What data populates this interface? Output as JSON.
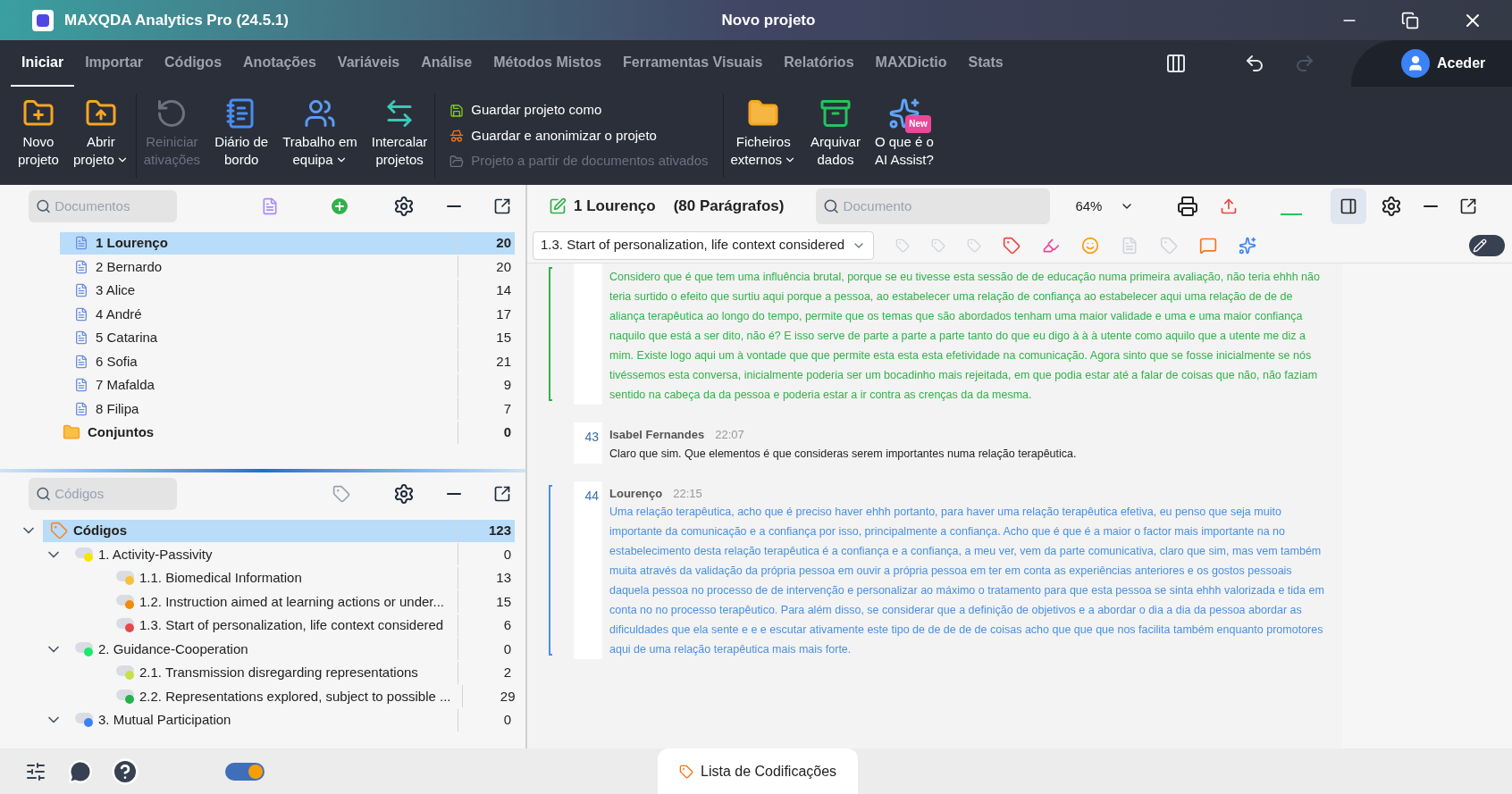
{
  "window": {
    "app_title": "MAXQDA Analytics Pro (24.5.1)",
    "project_title": "Novo projeto"
  },
  "menu_tabs": [
    {
      "label": "Iniciar",
      "selected": true
    },
    {
      "label": "Importar",
      "selected": false
    },
    {
      "label": "Códigos",
      "selected": false
    },
    {
      "label": "Anotações",
      "selected": false
    },
    {
      "label": "Variáveis",
      "selected": false
    },
    {
      "label": "Análise",
      "selected": false
    },
    {
      "label": "Métodos Mistos",
      "selected": false
    },
    {
      "label": "Ferramentas Visuais",
      "selected": false
    },
    {
      "label": "Relatórios",
      "selected": false
    },
    {
      "label": "MAXDictio",
      "selected": false
    },
    {
      "label": "Stats",
      "selected": false
    }
  ],
  "account": {
    "label": "Aceder"
  },
  "ribbon": [
    {
      "kind": "new",
      "lines": [
        "Novo",
        "projeto"
      ],
      "dropdown": false,
      "disabled": false
    },
    {
      "kind": "open",
      "lines": [
        "Abrir",
        "projeto"
      ],
      "dropdown": true,
      "disabled": false
    },
    {
      "kind": "reset",
      "lines": [
        "Reiniciar",
        "ativações"
      ],
      "dropdown": false,
      "disabled": true
    },
    {
      "kind": "logbook",
      "lines": [
        "Diário de",
        "bordo"
      ],
      "dropdown": false,
      "disabled": false
    },
    {
      "kind": "team",
      "lines": [
        "Trabalho em",
        "equipa"
      ],
      "dropdown": true,
      "disabled": false
    },
    {
      "kind": "merge",
      "lines": [
        "Intercalar",
        "projetos"
      ],
      "dropdown": false,
      "disabled": false
    },
    {
      "kind": "list",
      "items": [
        {
          "kind": "save",
          "label": "Guardar projeto como",
          "disabled": false
        },
        {
          "kind": "anon",
          "label": "Guardar e anonimizar o projeto",
          "disabled": false
        },
        {
          "kind": "folder",
          "label": "Projeto a partir de documentos ativados",
          "disabled": true
        }
      ]
    },
    {
      "kind": "external",
      "lines": [
        "Ficheiros",
        "externos"
      ],
      "dropdown": true,
      "disabled": false
    },
    {
      "kind": "archive",
      "lines": [
        "Arquivar",
        "dados"
      ],
      "dropdown": false,
      "disabled": false
    },
    {
      "kind": "ai",
      "lines": [
        "O que é o",
        "AI Assist?"
      ],
      "dropdown": false,
      "disabled": false,
      "badge": "New"
    }
  ],
  "documents": {
    "placeholder": "Documentos",
    "items": [
      {
        "kind": "document",
        "name": "1 Lourenço",
        "count": "20",
        "selected": true
      },
      {
        "kind": "document",
        "name": "2 Bernardo",
        "count": "20",
        "selected": false
      },
      {
        "kind": "document",
        "name": "3 Alice",
        "count": "14",
        "selected": false
      },
      {
        "kind": "document",
        "name": "4 André",
        "count": "17",
        "selected": false
      },
      {
        "kind": "document",
        "name": "5 Catarina",
        "count": "15",
        "selected": false
      },
      {
        "kind": "document",
        "name": "6 Sofia",
        "count": "21",
        "selected": false
      },
      {
        "kind": "document",
        "name": "7 Mafalda",
        "count": "9",
        "selected": false
      },
      {
        "kind": "document",
        "name": "8 Filipa",
        "count": "7",
        "selected": false
      },
      {
        "kind": "set",
        "name": "Conjuntos",
        "count": "0",
        "selected": false
      }
    ]
  },
  "codes": {
    "placeholder": "Códigos",
    "root": {
      "name": "Códigos",
      "count": "123",
      "selected": true,
      "expanded": true,
      "children": [
        {
          "name": "1. Activity-Passivity",
          "count": "0",
          "color": "#f5e600",
          "selected": false,
          "expanded": true,
          "children": [
            {
              "name": "1.1. Biomedical Information",
              "count": "13",
              "color": "#f7c23a",
              "selected": false
            },
            {
              "name": "1.2. Instruction aimed at learning actions or under...",
              "count": "15",
              "color": "#f58a07",
              "selected": false
            },
            {
              "name": "1.3. Start of personalization, life context considered",
              "count": "6",
              "color": "#e5484d",
              "selected": false
            }
          ]
        },
        {
          "name": "2. Guidance-Cooperation",
          "count": "0",
          "color": "#1ee86a",
          "selected": false,
          "expanded": true,
          "children": [
            {
              "name": "2.1. Transmission disregarding representations",
              "count": "2",
              "color": "#c6e04a",
              "selected": false
            },
            {
              "name": "2.2. Representations explored, subject to possible ...",
              "count": "29",
              "color": "#23b24b",
              "selected": false
            }
          ]
        },
        {
          "name": "3. Mutual Participation",
          "count": "0",
          "color": "#3b82f6",
          "selected": false,
          "expanded": true
        }
      ]
    }
  },
  "viewer": {
    "edit_mode": false,
    "document": "1 Lourenço",
    "paragraph_count": "(80 Parágrafos)",
    "search_placeholder": "Documento",
    "zoom": "64%",
    "active_code": "1.3. Start of personalization, life context considered",
    "paragraphs": [
      {
        "color": "#2fb34a",
        "text": "Considero que é que tem uma influência brutal, porque se eu tivesse esta sessão de de educação numa primeira avaliação, não teria ehhh não teria surtido o efeito que surtiu aqui porque a pessoa, ao estabelecer uma relação de confiança ao estabelecer aqui uma relação de de de aliança terapêutica ao longo do tempo, permite que os temas que são abordados tenham uma maior validade e uma e uma maior confiança naquilo que está a ser dito, não é? E isso serve de parte a parte a parte tanto do que eu digo à à à utente como aquilo que a utente me diz a mim. Existe logo aqui um à vontade que que permite esta esta esta efetividade na comunicação. Agora sinto que se fosse inicialmente se nós tivéssemos esta conversa, inicialmente poderia ser um bocadinho mais rejeitada, em que podia estar até a falar de coisas que não, não faziam sentido na cabeça da da pessoa e poderia estar a ir contra as crenças da da mesma."
      },
      {
        "number": "43",
        "speaker": "Isabel Fernandes",
        "time": "22:07",
        "text": "Claro que sim. Que elementos é que consideras serem importantes numa relação terapêutica."
      },
      {
        "number": "44",
        "speaker": "Lourenço",
        "time": "22:15",
        "color": "#4a90e2",
        "text": "Uma relação terapêutica, acho que é preciso haver ehhh portanto, para haver uma relação terapêutica efetiva, eu penso que seja muito importante da comunicação e a confiança por isso, principalmente a confiança. Acho que é que é a maior o factor mais importante na no estabelecimento desta relação terapêutica é a confiança e a confiança, a meu ver, vem da parte comunicativa, claro que sim, mas vem também muita através da validação da própria pessoa em ouvir a própria pessoa em ter em conta as experiências anteriores e os gostos pessoais daquela pessoa no processo de de intervenção e personalizar ao máximo o tratamento para que esta pessoa se sinta ehhh valorizada e tida em conta no no processo terapêutico. Para além disso, se considerar que a definição de objetivos e a abordar o dia a dia da pessoa abordar as dificuldades que ela sente e e e escutar ativamente este tipo de de de de de coisas acho que que que nos facilita também enquanto promotores aqui de uma relação terapêutica mais mais forte."
      }
    ]
  },
  "bottom_tab": {
    "label": "Lista de Codificações"
  },
  "theme_toggle": {
    "on": true
  }
}
